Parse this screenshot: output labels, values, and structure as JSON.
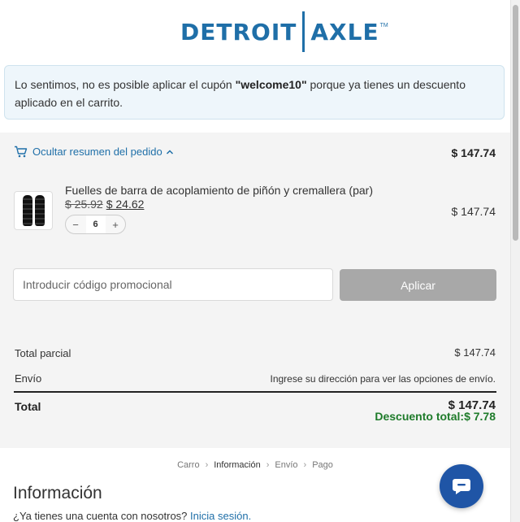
{
  "header": {
    "logo_left": "DETROIT",
    "logo_right": "AXLE",
    "logo_tm": "TM"
  },
  "notice": {
    "text_before": "Lo sentimos, no es posible aplicar el cupón ",
    "coupon": "\"welcome10\"",
    "text_after": " porque ya tienes un descuento aplicado en el carrito."
  },
  "summary": {
    "toggle_label": "Ocultar resumen del pedido",
    "total": "$ 147.74",
    "item": {
      "title": "Fuelles de barra de acoplamiento de piñón y cremallera (par)",
      "old_price": "$ 25.92",
      "new_price": "$ 24.62",
      "quantity": "6",
      "line_total": "$ 147.74"
    },
    "promo": {
      "placeholder": "Introducir código promocional",
      "apply_label": "Aplicar"
    },
    "subtotal_label": "Total parcial",
    "subtotal_value": "$ 147.74",
    "shipping_label": "Envío",
    "shipping_value": "Ingrese su dirección para ver las opciones de envío.",
    "total_label": "Total",
    "total_value": "$ 147.74",
    "discount_label": "Descuento total:",
    "discount_value": "$ 7.78"
  },
  "breadcrumb": [
    "Carro",
    "Información",
    "Envío",
    "Pago"
  ],
  "info": {
    "heading": "Información",
    "account_question": "¿Ya tienes una cuenta con nosotros?",
    "login_link": "Inicia sesión."
  },
  "colors": {
    "brand": "#1f6fa8",
    "discount": "#1e7b2a",
    "chat": "#1f55a6"
  }
}
